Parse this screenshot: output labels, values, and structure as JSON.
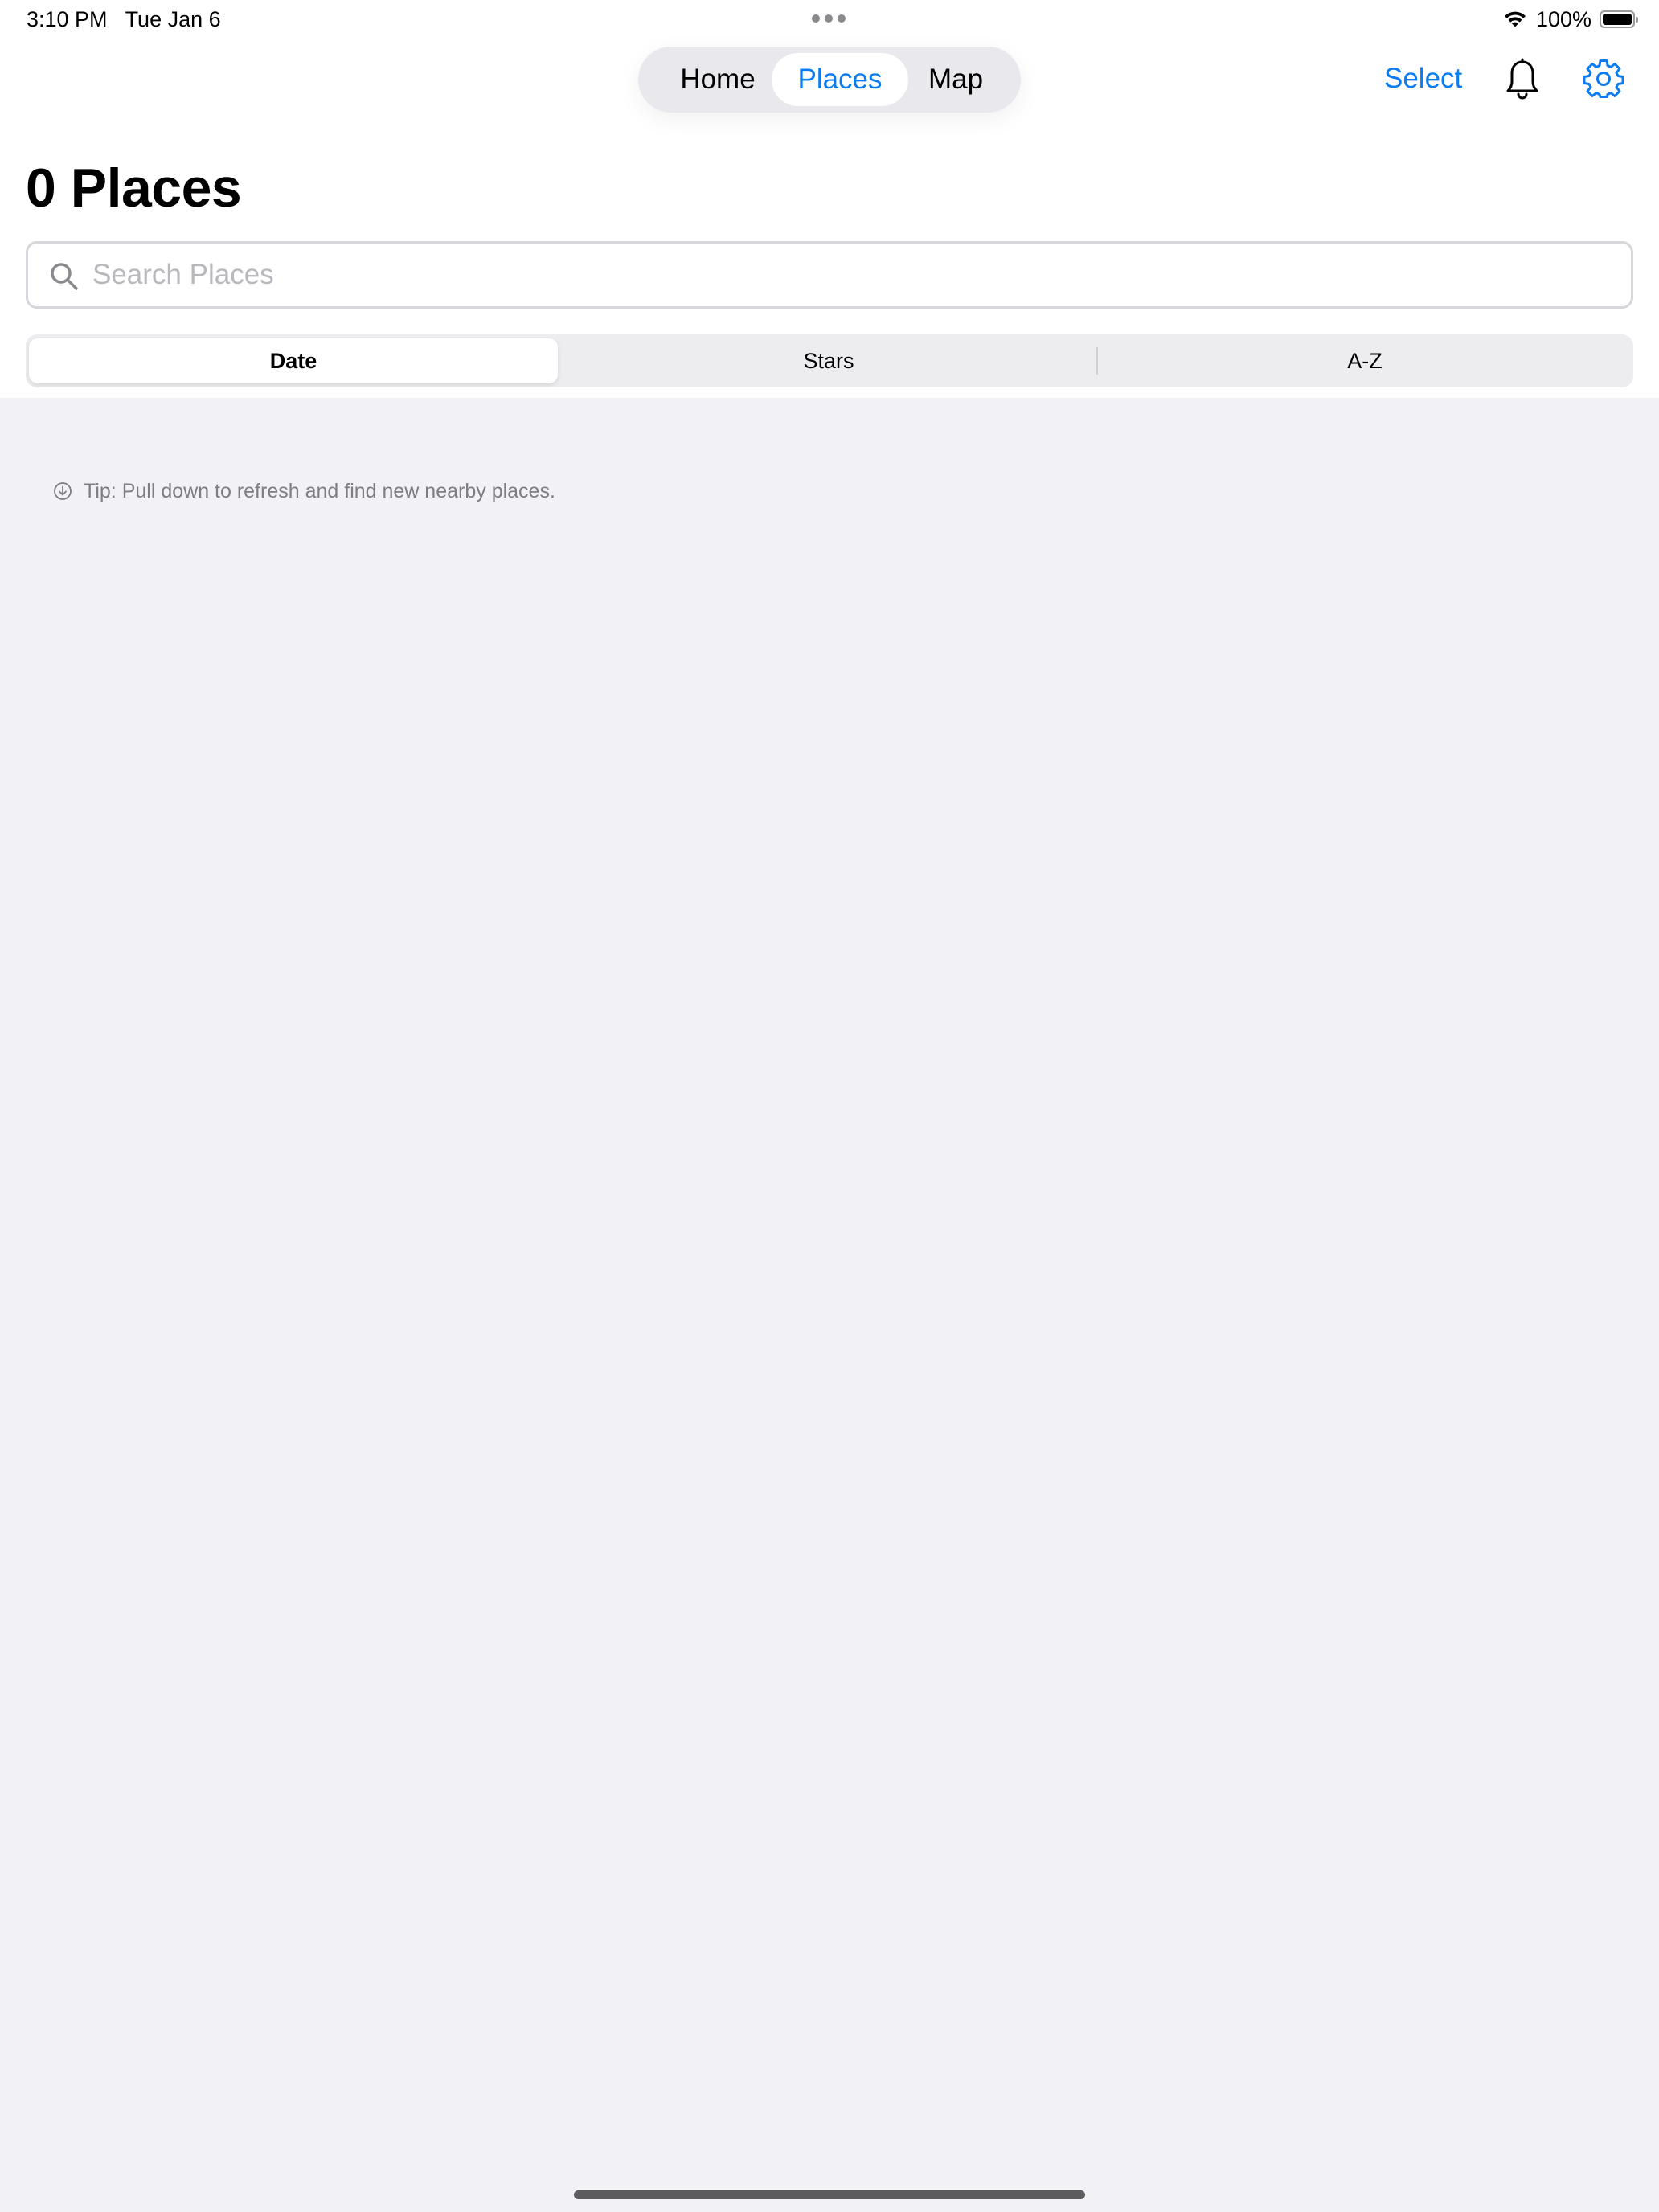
{
  "status_bar": {
    "time": "3:10 PM",
    "date": "Tue Jan 6",
    "battery_percent": "100%",
    "battery_level": 1.0,
    "icons": [
      "multitasking-dots-icon",
      "wifi-icon",
      "battery-icon"
    ]
  },
  "nav": {
    "tabs": [
      {
        "label": "Home"
      },
      {
        "label": "Places",
        "selected": true
      },
      {
        "label": "Map"
      }
    ],
    "select_label": "Select",
    "icons": [
      "bell-icon",
      "gear-icon"
    ],
    "accent_color": "#0a7cf0"
  },
  "page": {
    "title": "0 Places"
  },
  "search": {
    "placeholder": "Search Places",
    "value": "",
    "icon": "search-icon"
  },
  "sort": {
    "options": [
      {
        "label": "Date",
        "selected": true
      },
      {
        "label": "Stars"
      },
      {
        "label": "A-Z"
      }
    ]
  },
  "tip": {
    "icon": "arrow-down-circle-icon",
    "text": "Tip: Pull down to refresh and find new nearby places."
  },
  "colors": {
    "background": "#f1f1f6",
    "header_background": "#ffffff",
    "secondary_text": "#7d7d82"
  }
}
